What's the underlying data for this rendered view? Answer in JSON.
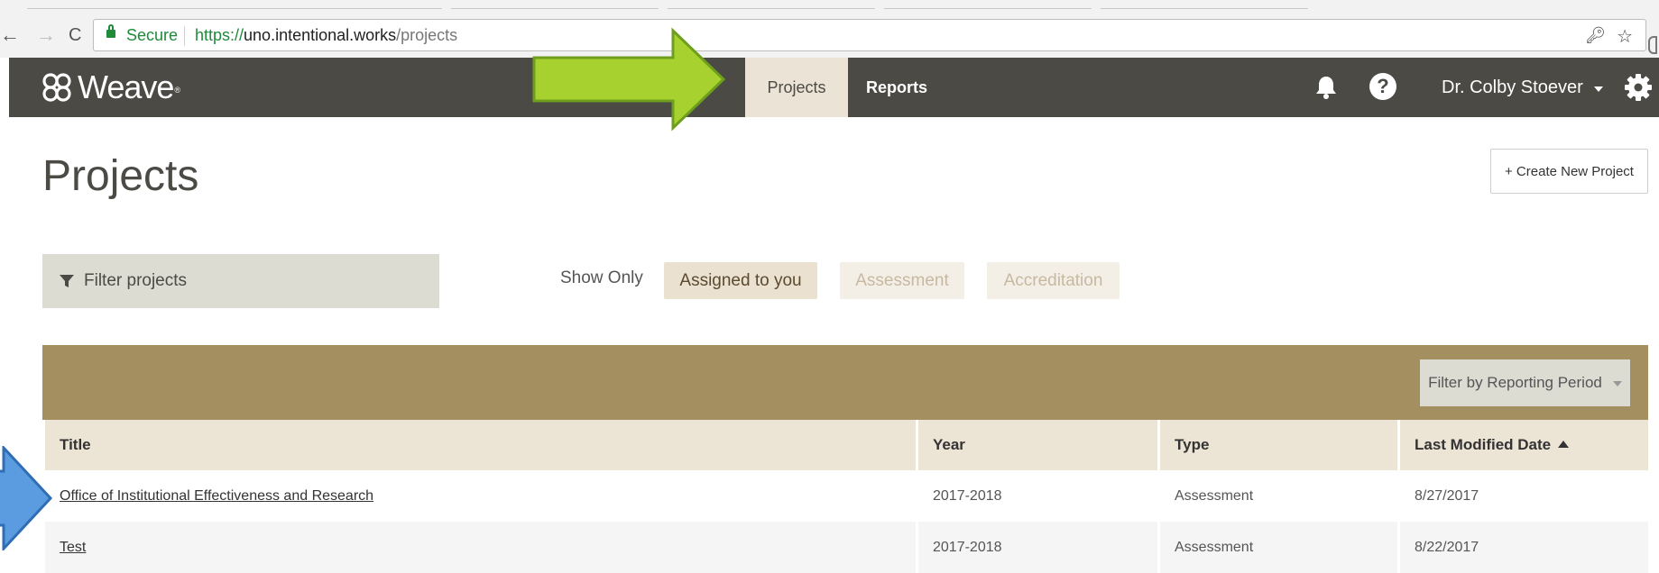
{
  "browser": {
    "secure_label": "Secure",
    "url_scheme": "https://",
    "url_host": "uno.intentional.works",
    "url_path": "/projects",
    "back_glyph": "←",
    "forward_glyph": "→",
    "reload_glyph": "C"
  },
  "header": {
    "logo_text": "Weave",
    "logo_tm": "®",
    "nav": {
      "projects_label": "Projects",
      "reports_label": "Reports"
    },
    "help_glyph": "?",
    "user_name": "Dr. Colby Stoever"
  },
  "page": {
    "title": "Projects",
    "create_button_label": "+ Create New Project",
    "filter_placeholder": "Filter projects",
    "show_only_label": "Show Only",
    "chips": {
      "assigned": "Assigned to you",
      "assessment": "Assessment",
      "accreditation": "Accreditation"
    },
    "period_filter_label": "Filter by Reporting Period"
  },
  "table": {
    "headers": {
      "title": "Title",
      "year": "Year",
      "type": "Type",
      "modified": "Last Modified Date"
    },
    "rows": [
      {
        "title": "Office of Institutional Effectiveness and Research",
        "year": "2017-2018",
        "type": "Assessment",
        "modified": "8/27/2017"
      },
      {
        "title": "Test",
        "year": "2017-2018",
        "type": "Assessment",
        "modified": "8/22/2017"
      }
    ]
  },
  "colors": {
    "header_bg": "#4b4a45",
    "active_tab": "#ebe3d5",
    "band": "#a38f60",
    "green_arrow": "#a6d12e",
    "blue_arrow": "#5b9be0"
  }
}
